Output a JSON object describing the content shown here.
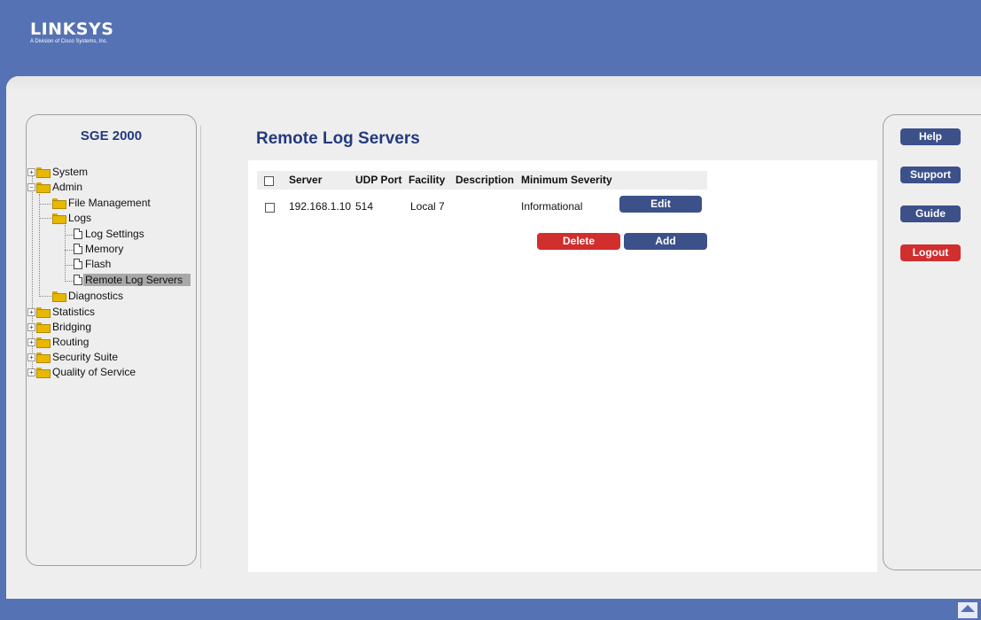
{
  "brand": {
    "name": "LINKSYS",
    "subtitle": "A Division of Cisco Systems, Inc."
  },
  "device": {
    "title": "SGE 2000"
  },
  "nav": {
    "system": "System",
    "admin": "Admin",
    "file_management": "File Management",
    "logs": "Logs",
    "log_settings": "Log Settings",
    "memory": "Memory",
    "flash": "Flash",
    "remote_log_servers": "Remote Log Servers",
    "diagnostics": "Diagnostics",
    "statistics": "Statistics",
    "bridging": "Bridging",
    "routing": "Routing",
    "security_suite": "Security Suite",
    "quality_of_service": "Quality of Service"
  },
  "page": {
    "title": "Remote Log Servers"
  },
  "table": {
    "headers": [
      "Server",
      "UDP Port",
      "Facility",
      "Description",
      "Minimum Severity"
    ],
    "rows": [
      {
        "server": "192.168.1.10",
        "udp_port": "514",
        "facility": "Local 7",
        "description": "",
        "min_severity": "Informational",
        "edit_label": "Edit"
      }
    ]
  },
  "actions": {
    "delete": "Delete",
    "add": "Add"
  },
  "side": {
    "help": "Help",
    "support": "Support",
    "guide": "Guide",
    "logout": "Logout"
  },
  "colors": {
    "accent_blue": "#3c5089",
    "accent_red": "#d12e2e",
    "title_blue": "#243a7e",
    "band_blue": "#5572b4"
  }
}
